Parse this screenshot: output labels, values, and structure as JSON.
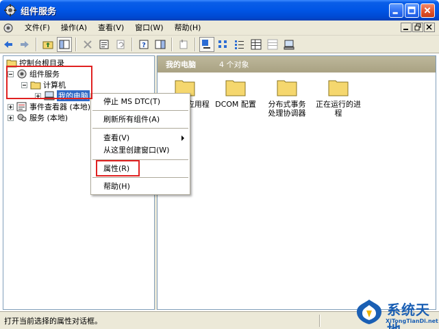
{
  "window": {
    "title": "组件服务"
  },
  "menubar": {
    "items": [
      "文件(F)",
      "操作(A)",
      "查看(V)",
      "窗口(W)",
      "帮助(H)"
    ]
  },
  "tree": {
    "root": "控制台根目录",
    "component_services": "组件服务",
    "computers": "计算机",
    "my_computer": "我的电脑",
    "event_viewer": "事件查看器 (本地)",
    "services": "服务 (本地)"
  },
  "rightpane": {
    "header_title": "我的电脑",
    "header_count": "4 个对象",
    "items": [
      {
        "label": "COM+ 应用程序"
      },
      {
        "label": "DCOM 配置"
      },
      {
        "label": "分布式事务处理协调器"
      },
      {
        "label": "正在运行的进程"
      }
    ]
  },
  "context_menu": {
    "stop_msdtc": "停止 MS DTC(T)",
    "refresh_all": "刷新所有组件(A)",
    "view": "查看(V)",
    "new_window": "从这里创建窗口(W)",
    "properties": "属性(R)",
    "help": "帮助(H)"
  },
  "statusbar": {
    "message": "打开当前选择的属性对话框。"
  },
  "watermark": {
    "brand": "系统天地",
    "url": "XiTongTianDi.net"
  },
  "colors": {
    "title_blue": "#0055e5",
    "selection": "#316ac5",
    "annotation_red": "#e02020",
    "folder_yellow": "#f5d76e"
  }
}
